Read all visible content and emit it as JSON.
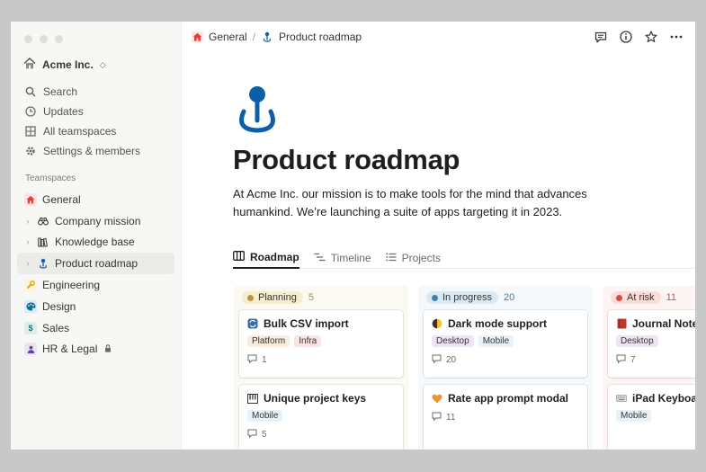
{
  "workspace": {
    "name": "Acme Inc."
  },
  "sidebar": {
    "nav": [
      {
        "label": "Search",
        "icon": "search-icon"
      },
      {
        "label": "Updates",
        "icon": "clock-icon"
      },
      {
        "label": "All teamspaces",
        "icon": "grid-icon"
      },
      {
        "label": "Settings & members",
        "icon": "gear-icon"
      }
    ],
    "teamspaces_title": "Teamspaces",
    "teams": [
      {
        "label": "General",
        "icon": "home-icon",
        "color": "#e03e3e"
      },
      {
        "label": "Company mission",
        "icon": "binoculars-icon"
      },
      {
        "label": "Knowledge base",
        "icon": "books-icon"
      },
      {
        "label": "Product roadmap",
        "icon": "pin-icon"
      },
      {
        "label": "Engineering",
        "icon": "wrench-icon",
        "color": "#dfab01"
      },
      {
        "label": "Design",
        "icon": "palette-icon",
        "color": "#0b6e99"
      },
      {
        "label": "Sales",
        "icon": "dollar-icon",
        "color": "#0f7b6c"
      },
      {
        "label": "HR & Legal",
        "icon": "person-icon",
        "color": "#6940a5"
      }
    ]
  },
  "breadcrumb": {
    "parent": "General",
    "current": "Product roadmap"
  },
  "page": {
    "title": "Product roadmap",
    "description": "At Acme Inc. our mission is to make tools for the mind that advances humankind. We’re launching a suite of apps targeting it in 2023."
  },
  "tabs": [
    {
      "label": "Roadmap",
      "icon": "board-icon"
    },
    {
      "label": "Timeline",
      "icon": "timeline-icon"
    },
    {
      "label": "Projects",
      "icon": "list-icon"
    }
  ],
  "board": {
    "columns": [
      {
        "label": "Planning",
        "count": "5",
        "bg": "#fbf9f3",
        "pill": "#f6eecf",
        "dot": "#c29243",
        "count_color": "#b38a40",
        "cards": [
          {
            "title": "Bulk CSV import",
            "emoji": "arrows-icon",
            "tags": [
              {
                "label": "Platform",
                "bg": "#fbecdd"
              },
              {
                "label": "Infra",
                "bg": "#fbe4e4"
              }
            ],
            "comments": "1"
          },
          {
            "title": "Unique project keys",
            "emoji": "piano-icon",
            "tags": [
              {
                "label": "Mobile",
                "bg": "#e7f3f8"
              }
            ],
            "comments": "5"
          }
        ]
      },
      {
        "label": "In progress",
        "count": "20",
        "bg": "#f5f9fb",
        "pill": "#dbe9f4",
        "dot": "#3f7fb0",
        "count_color": "#3f7fb0",
        "cards": [
          {
            "title": "Dark mode support",
            "emoji": "moon-icon",
            "tags": [
              {
                "label": "Desktop",
                "bg": "#ede5f5"
              },
              {
                "label": "Mobile",
                "bg": "#e7f3f8"
              }
            ],
            "comments": "20"
          },
          {
            "title": "Rate app prompt modal",
            "emoji": "heart-icon",
            "tags": [],
            "comments": "11"
          }
        ]
      },
      {
        "label": "At risk",
        "count": "11",
        "bg": "#fdf5f4",
        "pill": "#fbdcd9",
        "dot": "#d44c47",
        "count_color": "#c4554d",
        "cards": [
          {
            "title": "Journal Notebook",
            "emoji": "book-icon",
            "tags": [
              {
                "label": "Desktop",
                "bg": "#ede5f5"
              }
            ],
            "comments": "7"
          },
          {
            "title": "iPad Keyboard",
            "emoji": "keyboard-icon",
            "tags": [
              {
                "label": "Mobile",
                "bg": "#e7f3f8"
              }
            ],
            "comments": ""
          }
        ]
      }
    ]
  },
  "colors": {
    "accent_blue": "#0b5fa8"
  }
}
